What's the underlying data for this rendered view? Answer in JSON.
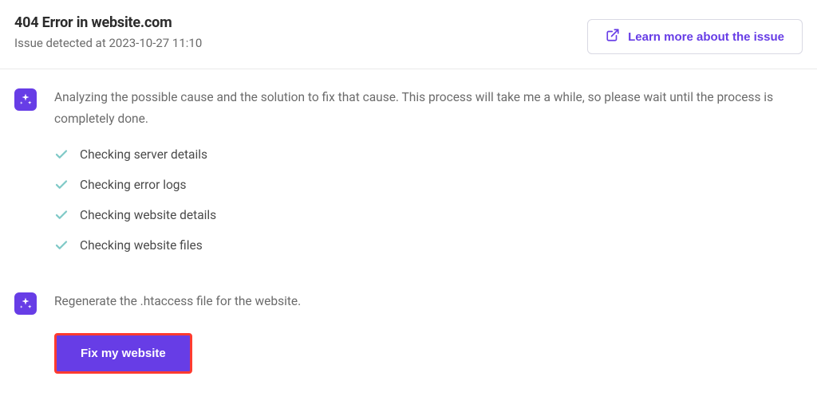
{
  "header": {
    "title": "404 Error in website.com",
    "timestamp": "Issue detected at 2023-10-27 11:10",
    "learn_more_label": "Learn more about the issue"
  },
  "analysis": {
    "message": "Analyzing the possible cause and the solution to fix that cause. This process will take me a while, so please wait until the process is completely done.",
    "steps": [
      "Checking server details",
      "Checking error logs",
      "Checking website details",
      "Checking website files"
    ]
  },
  "solution": {
    "message": "Regenerate the .htaccess file for the website.",
    "action_label": "Fix my website"
  },
  "icons": {
    "ai": "sparkle-icon",
    "external": "external-link-icon",
    "check": "check-icon"
  },
  "colors": {
    "primary": "#673de6",
    "highlight_border": "#ff3b30",
    "check": "#7fc9c7"
  }
}
